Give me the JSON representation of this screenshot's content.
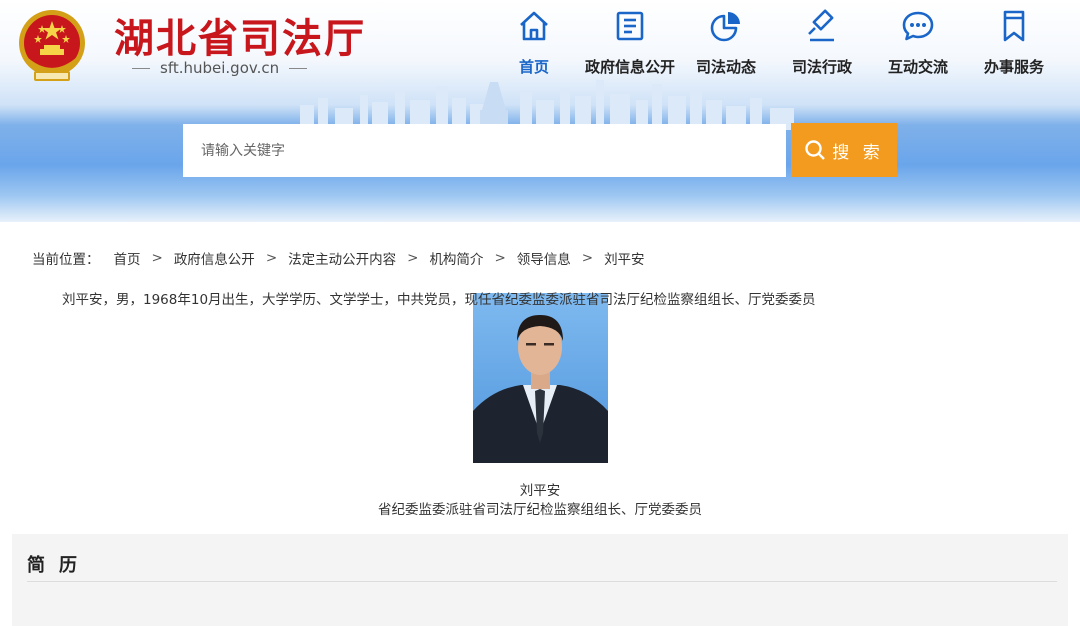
{
  "site": {
    "title": "湖北省司法厅",
    "domain": "sft.hubei.gov.cn"
  },
  "nav": {
    "items": [
      {
        "label": "首页",
        "icon": "home-icon",
        "active": true
      },
      {
        "label": "政府信息公开",
        "icon": "document-icon",
        "active": false
      },
      {
        "label": "司法动态",
        "icon": "pie-chart-icon",
        "active": false
      },
      {
        "label": "司法行政",
        "icon": "gavel-icon",
        "active": false
      },
      {
        "label": "互动交流",
        "icon": "chat-icon",
        "active": false
      },
      {
        "label": "办事服务",
        "icon": "bookmark-icon",
        "active": false
      }
    ],
    "active_color": "#1a66c8"
  },
  "search": {
    "placeholder": "请输入关键字",
    "value": "",
    "button_label": "搜 索",
    "button_color": "#f39b1f"
  },
  "breadcrumb": {
    "prefix": "当前位置：",
    "items": [
      "首页",
      "政府信息公开",
      "法定主动公开内容",
      "机构简介",
      "领导信息",
      "刘平安"
    ],
    "separator": ">"
  },
  "profile": {
    "name": "刘平安",
    "title": "省纪委监委派驻省司法厅纪检监察组组长、厅党委委员"
  },
  "resume": {
    "heading": "简历",
    "text": "刘平安，男，1968年10月出生，大学学历、文学学士，中共党员，现任省纪委监委派驻省司法厅纪检监察组组长、厅党委委员"
  },
  "colors": {
    "brand_red": "#c8161d",
    "header_blue": "#6aa5eb"
  }
}
